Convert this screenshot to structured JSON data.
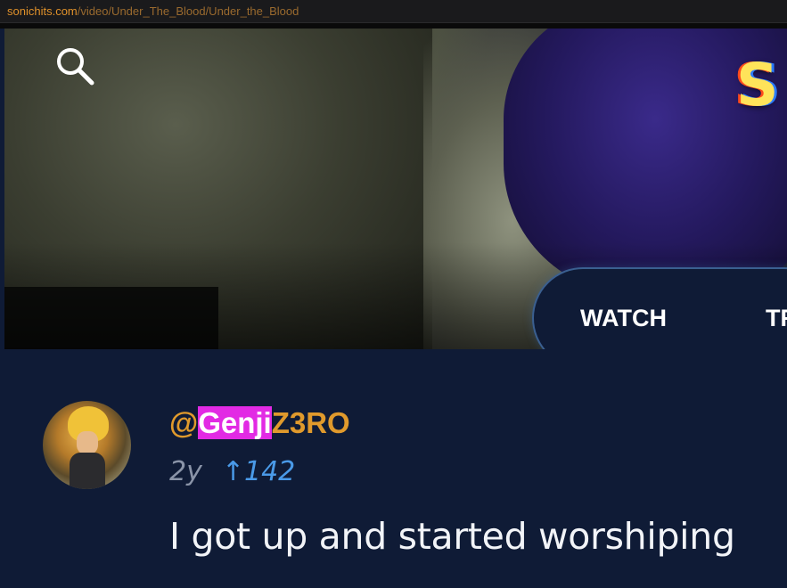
{
  "browser": {
    "url_domain": "sonichits.com",
    "url_path": "/video/Under_The_Blood/Under_the_Blood"
  },
  "header": {
    "logo_letter": "S",
    "search_icon": "search-icon",
    "nav": {
      "watch_label": "WATCH",
      "second_label_partial": "TR"
    }
  },
  "comment": {
    "username_prefix": "@",
    "username_highlight": "Genji",
    "username_rest": "Z3RO",
    "age": "2y",
    "upvote_icon": "up-arrow-icon",
    "upvotes": "↑142",
    "text": "I got up and started worshiping"
  },
  "colors": {
    "background": "#0f1b36",
    "username": "#e09a2c",
    "highlight": "#e22ae4",
    "upvote": "#4a9ae8",
    "url_domain": "#e0912a"
  }
}
